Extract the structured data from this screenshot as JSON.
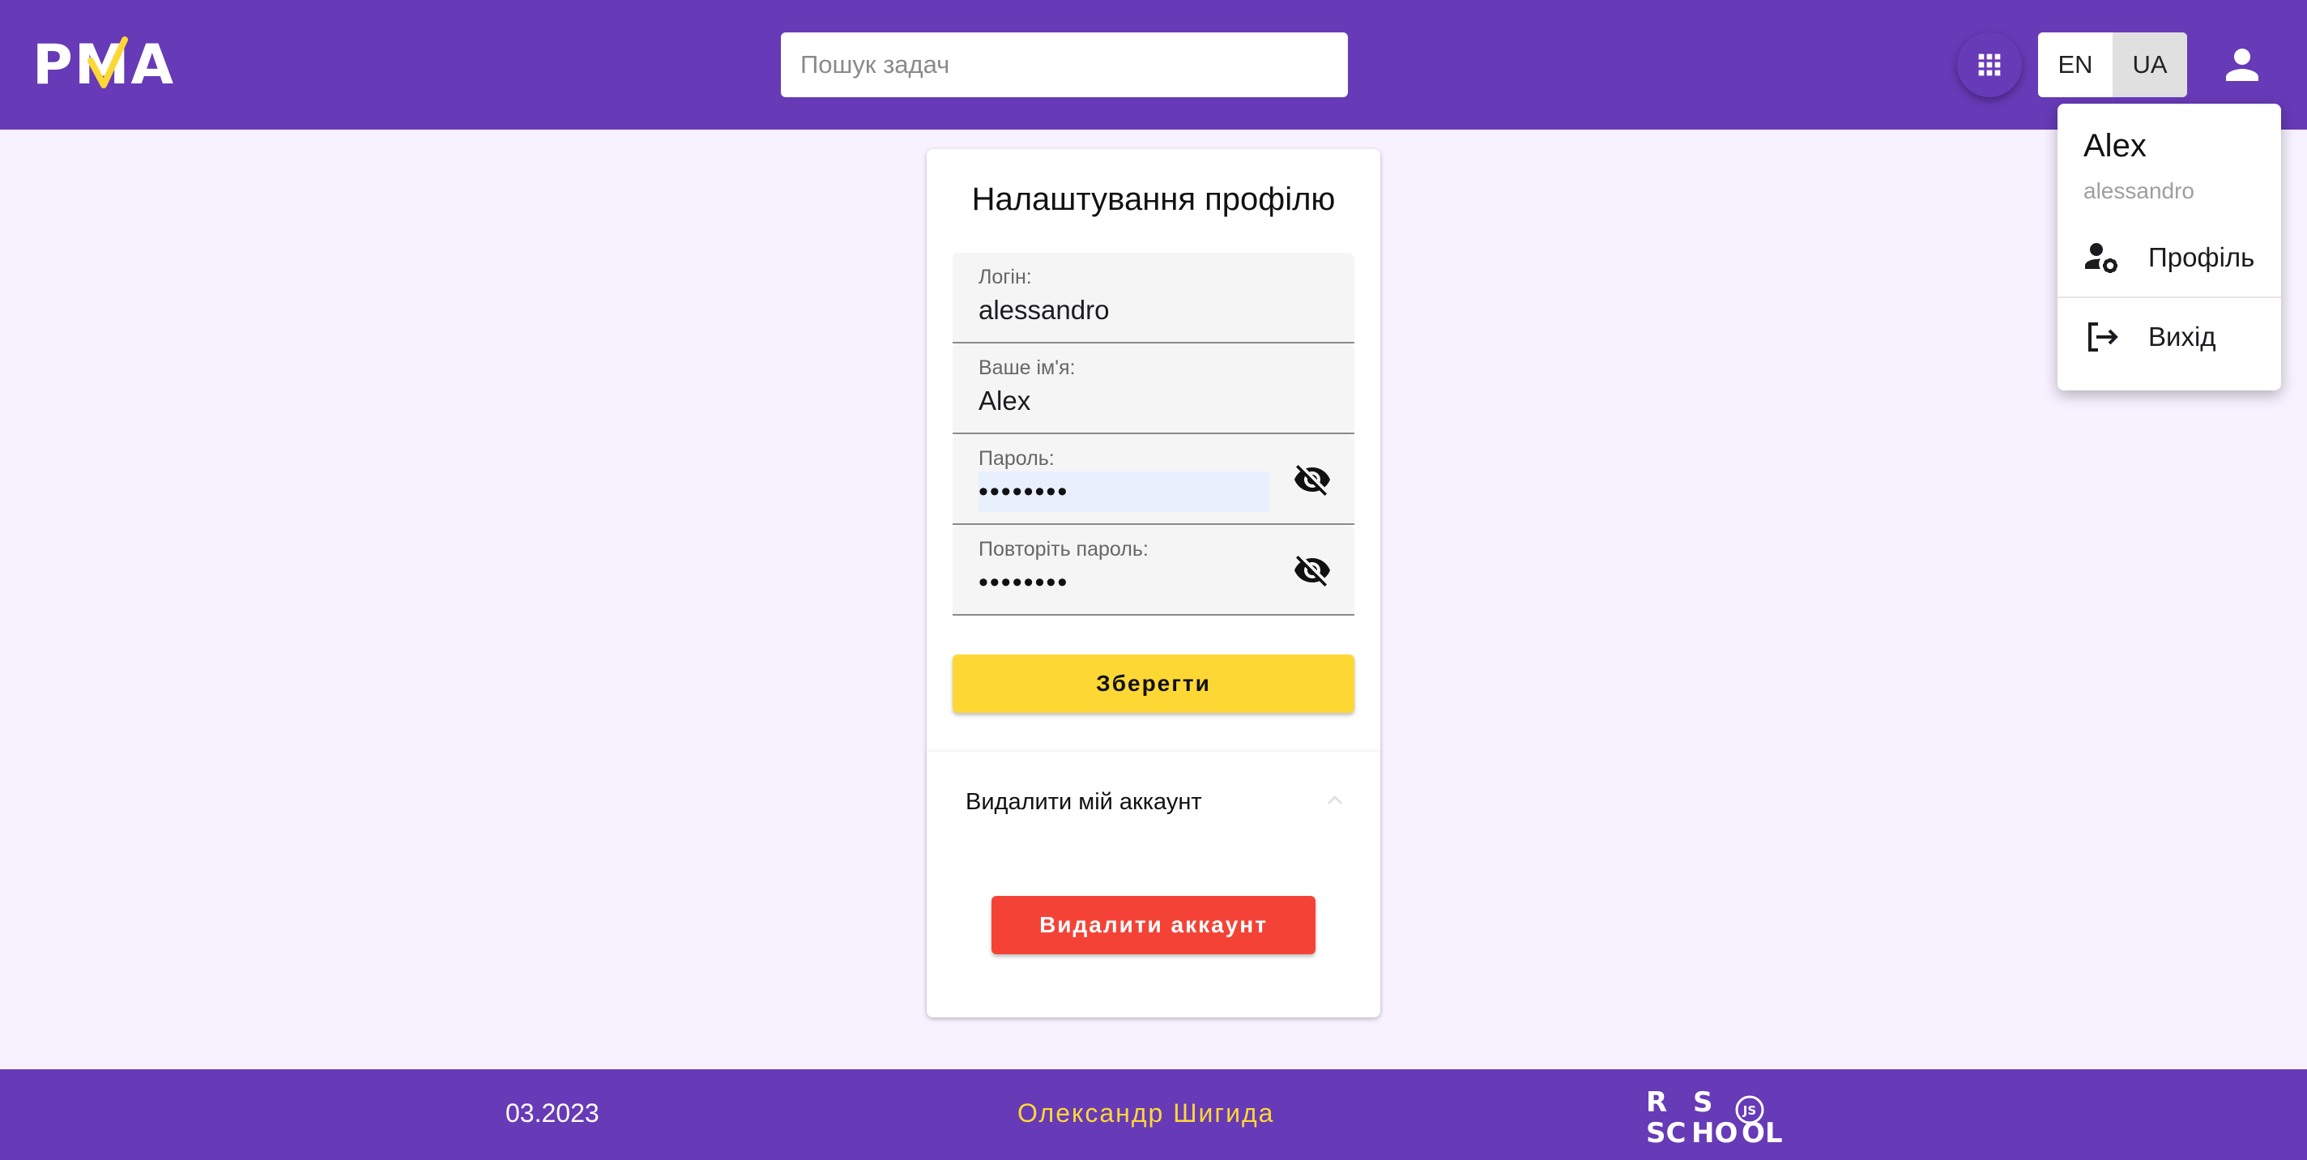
{
  "header": {
    "logo": {
      "p": "P",
      "m": "M",
      "a": "A"
    },
    "search": {
      "placeholder": "Пошук задач"
    },
    "languages": [
      {
        "label": "EN",
        "active": false
      },
      {
        "label": "UA",
        "active": true
      }
    ]
  },
  "user_menu": {
    "name": "Alex",
    "login": "alessandro",
    "items": [
      {
        "label": "Профіль",
        "icon": "user-settings-icon"
      },
      {
        "label": "Вихід",
        "icon": "logout-icon"
      }
    ]
  },
  "profile": {
    "title": "Налаштування профілю",
    "fields": {
      "login": {
        "label": "Логін:",
        "value": "alessandro"
      },
      "name": {
        "label": "Ваше ім'я:",
        "value": "Alex"
      },
      "password": {
        "label": "Пароль:",
        "value": "••••••••"
      },
      "repeat_password": {
        "label": "Повторіть пароль:",
        "value": "••••••••"
      }
    },
    "save_label": "Зберегти",
    "delete_section": {
      "title": "Видалити мій аккаунт",
      "button_label": "Видалити аккаунт"
    }
  },
  "footer": {
    "date": "03.2023",
    "author": "Олександр Шигида",
    "school_logo": "RS School JS"
  },
  "colors": {
    "primary": "#673ab7",
    "background": "#f8f1ff",
    "accent_yellow": "#fdd835",
    "danger": "#f44336"
  }
}
